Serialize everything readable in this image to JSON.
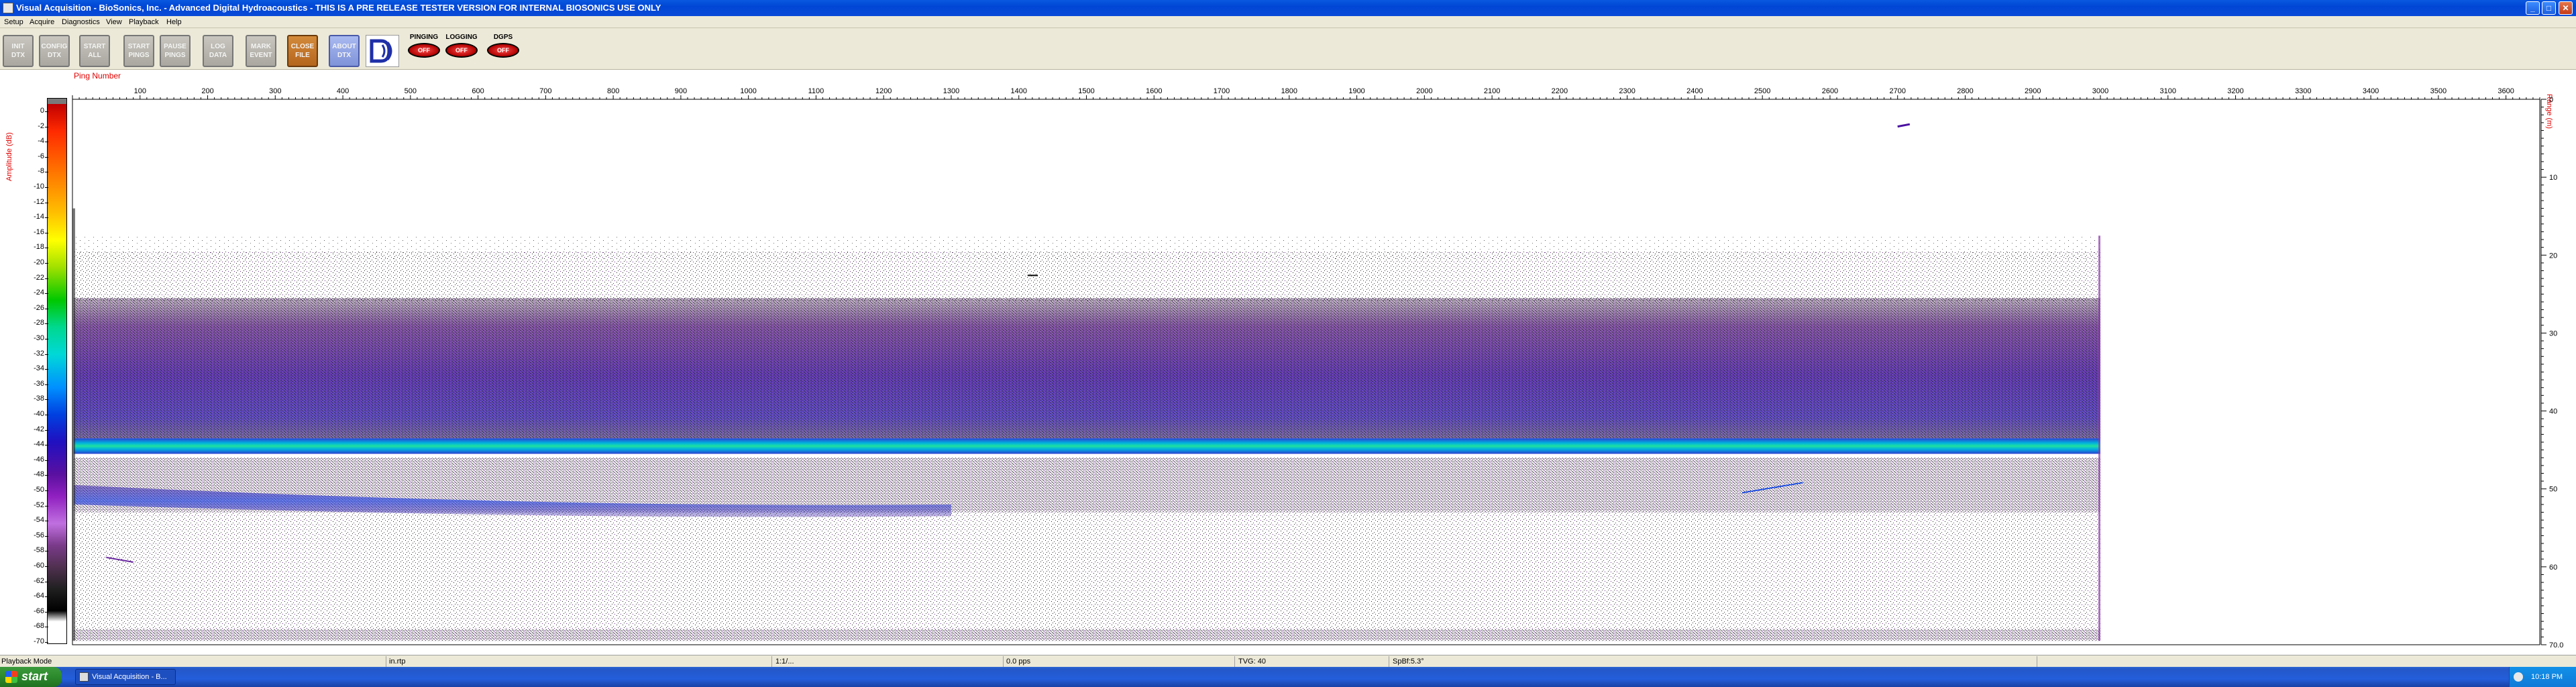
{
  "window": {
    "title": "Visual Acquisition  -  BioSonics, Inc.  -  Advanced Digital Hydroacoustics  -  THIS IS A PRE RELEASE TESTER VERSION FOR INTERNAL BIOSONICS USE ONLY"
  },
  "menu": [
    "Setup",
    "Acquire",
    "Diagnostics",
    "View",
    "Playback",
    "Help"
  ],
  "toolbar": {
    "buttons": [
      {
        "line1": "INIT",
        "line2": "DTX"
      },
      {
        "line1": "CONFIG",
        "line2": "DTX"
      },
      {
        "line1": "START",
        "line2": "ALL"
      },
      {
        "line1": "START",
        "line2": "PINGS"
      },
      {
        "line1": "PAUSE",
        "line2": "PINGS"
      },
      {
        "line1": "LOG",
        "line2": "DATA"
      },
      {
        "line1": "MARK",
        "line2": "EVENT"
      },
      {
        "line1": "CLOSE",
        "line2": "FILE"
      },
      {
        "line1": "ABOUT",
        "line2": "DTX"
      }
    ],
    "indicators": [
      {
        "label": "PINGING",
        "state": "OFF"
      },
      {
        "label": "LOGGING",
        "state": "OFF"
      },
      {
        "label": "DGPS",
        "state": "OFF"
      }
    ]
  },
  "echogram": {
    "x_axis_label": "Ping Number",
    "x_ticks": [
      "100",
      "200",
      "300",
      "400",
      "500",
      "600",
      "700",
      "800",
      "900",
      "1000",
      "1100",
      "1200",
      "1300",
      "1400",
      "1500",
      "1600",
      "1700",
      "1800",
      "1900",
      "2000",
      "2100",
      "2200",
      "2300",
      "2400",
      "2500",
      "2600",
      "2700",
      "2800",
      "2900",
      "3000",
      "3100",
      "3200",
      "3300",
      "3400",
      "3500",
      "3600"
    ],
    "right_axis_label": "Range (m)",
    "right_ticks": [
      "0",
      "10",
      "20",
      "30",
      "40",
      "50",
      "60",
      "70.0"
    ],
    "colorbar_label": "Amplitude (dB)",
    "colorbar_ticks": [
      "0",
      "-2",
      "-4",
      "-6",
      "-8",
      "-10",
      "-12",
      "-14",
      "-16",
      "-18",
      "-20",
      "-22",
      "-24",
      "-26",
      "-28",
      "-30",
      "-32",
      "-34",
      "-36",
      "-38",
      "-40",
      "-42",
      "-44",
      "-46",
      "-48",
      "-50",
      "-52",
      "-54",
      "-56",
      "-58",
      "-60",
      "-62",
      "-64",
      "-66",
      "-68",
      "-70"
    ]
  },
  "chart_data": {
    "type": "heatmap",
    "x_axis_label": "Ping Number",
    "x_range": [
      0,
      3650
    ],
    "data_ping_range": [
      0,
      3000
    ],
    "y_axis_label": "Range (m)",
    "y_range": [
      0,
      70
    ],
    "y_ticks": [
      0,
      10,
      20,
      30,
      40,
      50,
      60,
      70
    ],
    "colorbar": {
      "label": "Amplitude (dB)",
      "range": [
        0,
        -70
      ],
      "step": 2
    }
  },
  "status": {
    "mode": "Playback Mode",
    "field2": "in.rtp",
    "field3": "1:1/...",
    "field4": "0.0 pps",
    "field5": "TVG: 40",
    "field6": "SpBf:5.3°"
  },
  "taskbar": {
    "start": "start",
    "task": "Visual Acquisition  -  B...",
    "clock": "10:18 PM"
  }
}
